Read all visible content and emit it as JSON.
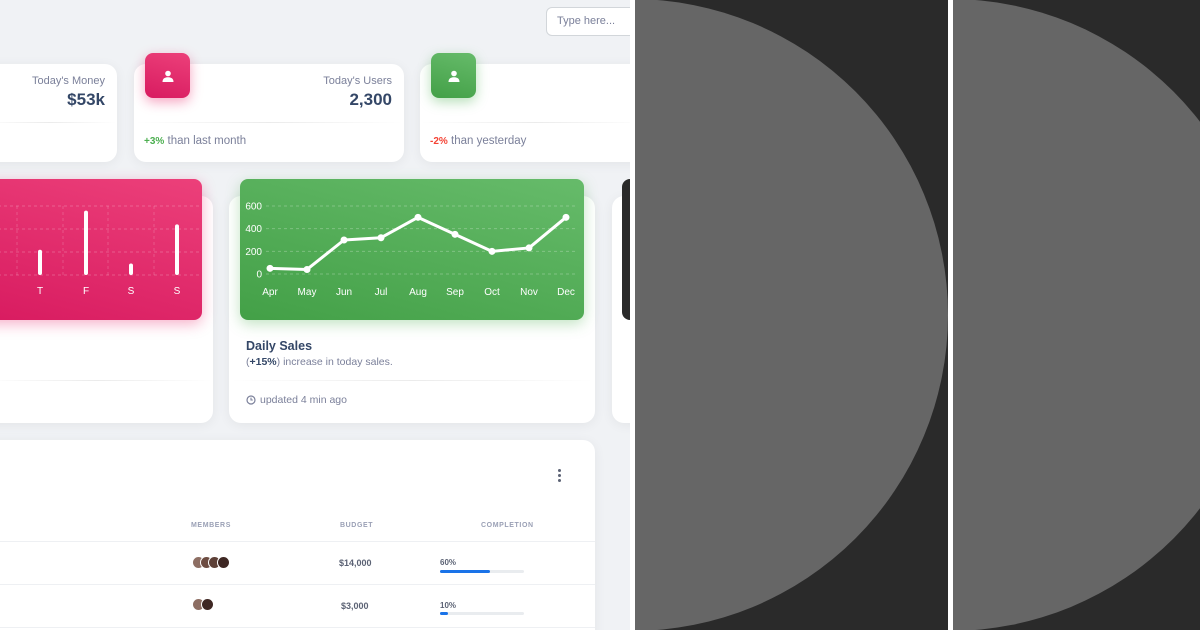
{
  "search": {
    "placeholder": "Type here..."
  },
  "stats": [
    {
      "label": "Today's Money",
      "value": "$53k"
    },
    {
      "label": "Today's Users",
      "value": "2,300",
      "change": "+3%",
      "change_text": "than last month",
      "icon": "person-icon"
    },
    {
      "change": "-2%",
      "change_text": "than yesterday",
      "icon": "person-icon"
    }
  ],
  "daily_sales": {
    "title": "Daily Sales",
    "sub_prefix": "(",
    "sub_pct": "+15%",
    "sub_suffix": ") increase in today sales.",
    "updated": "updated 4 min ago"
  },
  "chart_data": [
    {
      "type": "bar",
      "categories": [
        "T",
        "F",
        "S",
        "S"
      ],
      "values": [
        22,
        56,
        10,
        44
      ],
      "xlabel": "",
      "ylabel": ""
    },
    {
      "type": "line",
      "categories": [
        "Apr",
        "May",
        "Jun",
        "Jul",
        "Aug",
        "Sep",
        "Oct",
        "Nov",
        "Dec"
      ],
      "values": [
        50,
        40,
        300,
        320,
        500,
        350,
        200,
        230,
        500
      ],
      "yticks": [
        0,
        200,
        400,
        600
      ],
      "ylim": [
        0,
        600
      ],
      "grid": true,
      "xlabel": "",
      "ylabel": ""
    }
  ],
  "projects": {
    "headers": {
      "members": "MEMBERS",
      "budget": "BUDGET",
      "completion": "COMPLETION"
    },
    "rows": [
      {
        "budget": "$14,000",
        "completion_text": "60%",
        "completion": 0.6,
        "members": 4
      },
      {
        "budget": "$3,000",
        "completion_text": "10%",
        "completion": 0.1,
        "members": 2
      }
    ]
  },
  "colors": {
    "pink": "#e91e63",
    "green": "#4caf50",
    "dark": "#2a2a2a",
    "blue": "#1a73e8"
  }
}
